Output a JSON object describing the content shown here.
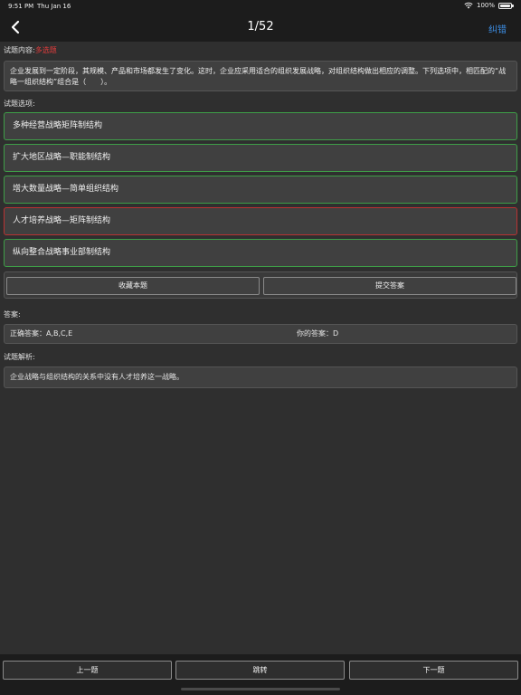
{
  "status": {
    "time": "9:51 PM",
    "date": "Thu Jan 16",
    "battery": "100%",
    "battery_level": 1.0
  },
  "nav": {
    "title": "1/52",
    "action_label": "纠错",
    "back_icon": "chevron-left-icon"
  },
  "question": {
    "label": "试题内容:",
    "type": "多选题",
    "text": "企业发展到一定阶段，其规模、产品和市场都发生了变化。这时，企业应采用适合的组织发展战略，对组织结构做出相应的调整。下列选项中，相匹配的“战略一组织结构”组合是（　　）。"
  },
  "options": {
    "label": "试题选项:",
    "items": [
      {
        "text": "多种经营战略矩阵制结构",
        "state": "correct"
      },
      {
        "text": "扩大地区战略—职能制结构",
        "state": "correct"
      },
      {
        "text": "增大数量战略—简单组织结构",
        "state": "correct"
      },
      {
        "text": "人才培养战略—矩阵制结构",
        "state": "wrong"
      },
      {
        "text": "纵向整合战略事业部制结构",
        "state": "correct"
      }
    ]
  },
  "actions": {
    "favorite_label": "收藏本题",
    "submit_label": "提交答案"
  },
  "answer": {
    "label": "答案:",
    "correct_prefix": "正确答案：",
    "correct_value": "A,B,C,E",
    "yours_prefix": "你的答案：",
    "yours_value": "D"
  },
  "analysis": {
    "label": "试题解析:",
    "text": "企业战略与组织结构的关系中没有人才培养这一战略。"
  },
  "bottom": {
    "prev_label": "上一题",
    "jump_label": "跳转",
    "next_label": "下一题"
  },
  "colors": {
    "accent": "#3d8fe6",
    "correct": "#3e9e47",
    "wrong": "#b83232",
    "question_type": "#e03c3c"
  }
}
